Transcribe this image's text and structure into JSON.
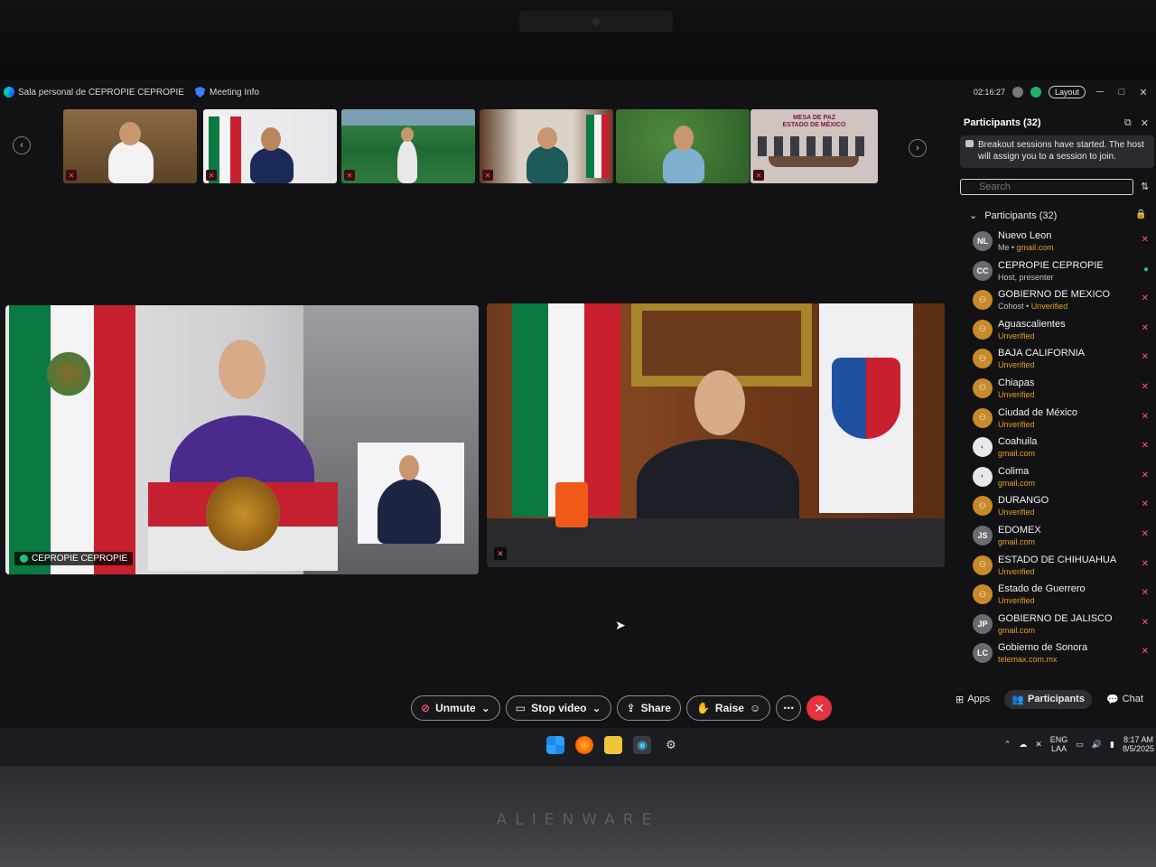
{
  "window": {
    "room_name": "Sala personal de CEPROPIE CEPROPIE",
    "meeting_info": "Meeting Info",
    "timer": "02:16:27",
    "layout_label": "Layout"
  },
  "strip": {
    "t6_title_line1": "MESA DE PAZ",
    "t6_title_line2": "ESTADO DE MÉXICO"
  },
  "main": {
    "left_name": "CEPROPIE CEPROPIE"
  },
  "controls": {
    "unmute": "Unmute",
    "stop_video": "Stop video",
    "share": "Share",
    "raise": "Raise"
  },
  "sidebar": {
    "title": "Participants (32)",
    "banner": "Breakout sessions have started. The host will assign you to a session to join.",
    "search_placeholder": "Search",
    "group_label": "Participants (32)",
    "participants": [
      {
        "initials": "NL",
        "name": "Nuevo Leon",
        "sub_gray": "Me •",
        "sub": "gmail.com"
      },
      {
        "initials": "CC",
        "name": "CEPROPIE CEPROPIE",
        "sub_gray": "Host, presenter",
        "sub": ""
      },
      {
        "initials": "",
        "name": "GOBIERNO DE MEXICO",
        "sub_gray": "Cohost •",
        "sub": "Unverified"
      },
      {
        "initials": "",
        "name": "Aguascalientes",
        "sub_gray": "",
        "sub": "Unverified"
      },
      {
        "initials": "",
        "name": "BAJA CALIFORNIA",
        "sub_gray": "",
        "sub": "Unverified"
      },
      {
        "initials": "",
        "name": "Chiapas",
        "sub_gray": "",
        "sub": "Unverified"
      },
      {
        "initials": "",
        "name": "Ciudad de México",
        "sub_gray": "",
        "sub": "Unverified"
      },
      {
        "initials": "",
        "name": "Coahuila",
        "sub_gray": "",
        "sub": "gmail.com"
      },
      {
        "initials": "",
        "name": "Colima",
        "sub_gray": "",
        "sub": "gmail.com"
      },
      {
        "initials": "",
        "name": "DURANGO",
        "sub_gray": "",
        "sub": "Unverified"
      },
      {
        "initials": "JS",
        "name": "EDOMEX",
        "sub_gray": "",
        "sub": "gmail.com"
      },
      {
        "initials": "",
        "name": "ESTADO DE CHIHUAHUA",
        "sub_gray": "",
        "sub": "Unverified"
      },
      {
        "initials": "",
        "name": "Estado de Guerrero",
        "sub_gray": "",
        "sub": "Unverified"
      },
      {
        "initials": "JP",
        "name": "GOBIERNO DE JALISCO",
        "sub_gray": "",
        "sub": "gmail.com"
      },
      {
        "initials": "LC",
        "name": "Gobierno de Sonora",
        "sub_gray": "",
        "sub": "telemax.com.mx"
      }
    ],
    "tabs": {
      "apps": "Apps",
      "participants": "Participants",
      "chat": "Chat"
    }
  },
  "taskbar": {
    "lang1": "ENG",
    "lang2": "LAA",
    "time": "8:17 AM",
    "date": "8/5/2025"
  },
  "laptop": {
    "brand": "ALIENWARE"
  },
  "colors": {
    "accent_orange": "#e0a020",
    "mute_red": "#ff5a66",
    "end_call": "#e5333f"
  }
}
